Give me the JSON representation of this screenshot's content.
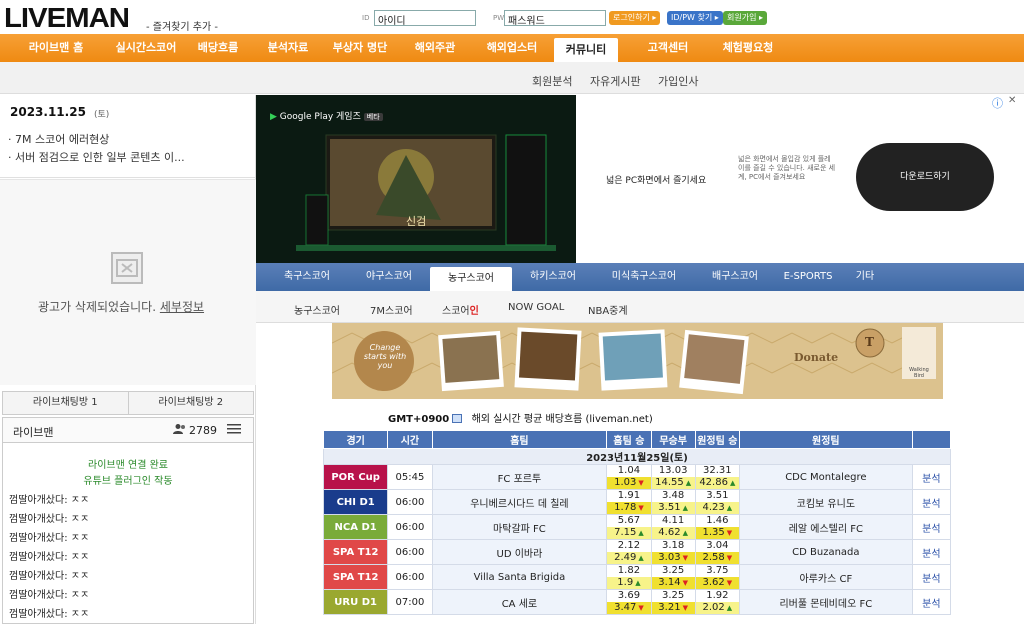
{
  "header": {
    "logo": "LIVEMAN",
    "bookmark": "- 즐겨찾기 추가 -",
    "id_label": "ID",
    "id_value": "아이디",
    "pw_label": "PW",
    "pw_value": "패스워드",
    "login_btn": "로그인하기 ▸",
    "find_btn": "ID/PW 찾기 ▸",
    "join_btn": "회원가입 ▸"
  },
  "nav": {
    "items": [
      "라이브맨 홈",
      "실시간스코어",
      "배당흐름",
      "분석자료",
      "부상자 명단",
      "해외주관",
      "해외업스터",
      "커뮤니티",
      "고객센터",
      "체험평요청"
    ],
    "active_index": 7,
    "sub": [
      "회원분석",
      "자유게시판",
      "가입인사"
    ]
  },
  "left": {
    "date": "2023.11.25",
    "day": "(토)",
    "notices": [
      "· 7M 스코어 에러현상",
      "· 서버 점검으로 인한 일부 콘텐츠 이..."
    ],
    "ad_removed": "광고가 삭제되었습니다.",
    "ad_detail": "세부정보",
    "chat_tabs": [
      "라이브채팅방 1",
      "라이브채팅방 2"
    ],
    "chat_title": "라이브맨",
    "chat_users": "2789",
    "chat_dots": "•••",
    "chat_status": [
      "라이브맨 연결 완료",
      "유튜브 플러그인 작동"
    ],
    "chat_messages": [
      {
        "user": "껌딸아개샀다:",
        "text": "ㅈㅈ"
      },
      {
        "user": "껌딸아개샀다:",
        "text": "ㅈㅈ"
      },
      {
        "user": "껌딸아개샀다:",
        "text": "ㅈㅈ"
      },
      {
        "user": "껌딸아개샀다:",
        "text": "ㅈㅈ"
      },
      {
        "user": "껌딸아개샀다:",
        "text": "ㅈㅈ"
      },
      {
        "user": "껌딸아개샀다:",
        "text": "ㅈㅈ"
      },
      {
        "user": "껌딸아개샀다:",
        "text": "ㅈㅈ"
      }
    ]
  },
  "ad": {
    "store": "Google Play 게임즈",
    "store_badge": "베타",
    "game_title": "신검",
    "headline": "넓은 PC화면에서 즐기세요",
    "desc": "넓은 화면에서 몰입감 있게 플레이를 즐길 수 있습니다. 새로운 세계, PC에서 즐겨보세요",
    "cta": "다운로드하기",
    "info_icon": "ⓘ",
    "close_icon": "✕"
  },
  "sport_tabs": {
    "items": [
      "축구스코어",
      "야구스코어",
      "농구스코어",
      "하키스코어",
      "미식축구스코어",
      "배구스코어",
      "E-SPORTS",
      "기타"
    ],
    "active_index": 2,
    "sub": [
      "농구스코어",
      "7M스코어",
      "스코어",
      "인",
      "NOW GOAL",
      "NBA중계"
    ]
  },
  "donate": {
    "stamp_text": "Change starts with you",
    "label": "Donate",
    "seal_letter": "T",
    "badge_text": "Walking Bird"
  },
  "odds": {
    "gmt": "GMT+0900",
    "source": "해외 실시간 평균 배당흐름 (liveman.net)",
    "headers": [
      "경기",
      "시간",
      "홈팀",
      "홈팀 승",
      "무승부",
      "원정팀 승",
      "원정팀",
      ""
    ],
    "date_row": "2023년11월25일(토)",
    "analysis_label": "분석",
    "rows": [
      {
        "league": "POR Cup",
        "color": "#b8124a",
        "time": "05:45",
        "home": "FC 포르투",
        "h1": "1.04",
        "h2": "1.03",
        "h2a": "▼",
        "d1": "13.03",
        "d2": "14.55",
        "d2a": "▲",
        "a1": "32.31",
        "a2": "42.86",
        "a2a": "▲",
        "away": "CDC Montalegre",
        "hl": [
          1,
          0,
          0
        ]
      },
      {
        "league": "CHI D1",
        "color": "#1a3c8c",
        "time": "06:00",
        "home": "우니베르시다드 데 칠레",
        "h1": "1.91",
        "h2": "1.78",
        "h2a": "▼",
        "d1": "3.48",
        "d2": "3.51",
        "d2a": "▲",
        "a1": "3.51",
        "a2": "4.23",
        "a2a": "▲",
        "away": "코킴보 유니도",
        "hl": [
          1,
          0,
          0
        ]
      },
      {
        "league": "NCA D1",
        "color": "#7aab3a",
        "time": "06:00",
        "home": "마탁갈파 FC",
        "h1": "5.67",
        "h2": "7.15",
        "h2a": "▲",
        "d1": "4.11",
        "d2": "4.62",
        "d2a": "▲",
        "a1": "1.46",
        "a2": "1.35",
        "a2a": "▼",
        "away": "레알 에스텔리 FC",
        "hl": [
          0,
          0,
          1
        ]
      },
      {
        "league": "SPA T12",
        "color": "#e04848",
        "time": "06:00",
        "home": "UD 이바라",
        "h1": "2.12",
        "h2": "2.49",
        "h2a": "▲",
        "d1": "3.18",
        "d2": "3.03",
        "d2a": "▼",
        "a1": "3.04",
        "a2": "2.58",
        "a2a": "▼",
        "away": "CD Buzanada",
        "hl": [
          0,
          1,
          1
        ]
      },
      {
        "league": "SPA T12",
        "color": "#e04848",
        "time": "06:00",
        "home": "Villa Santa Brigida",
        "h1": "1.82",
        "h2": "1.9",
        "h2a": "▲",
        "d1": "3.25",
        "d2": "3.14",
        "d2a": "▼",
        "a1": "3.75",
        "a2": "3.62",
        "a2a": "▼",
        "away": "아루카스 CF",
        "hl": [
          0,
          1,
          1
        ]
      },
      {
        "league": "URU D1",
        "color": "#9aa830",
        "time": "07:00",
        "home": "CA 세로",
        "h1": "3.69",
        "h2": "3.47",
        "h2a": "▼",
        "d1": "3.25",
        "d2": "3.21",
        "d2a": "▼",
        "a1": "1.92",
        "a2": "2.02",
        "a2a": "▲",
        "away": "리버풀 몬테비데오 FC",
        "hl": [
          1,
          1,
          0
        ]
      }
    ]
  }
}
